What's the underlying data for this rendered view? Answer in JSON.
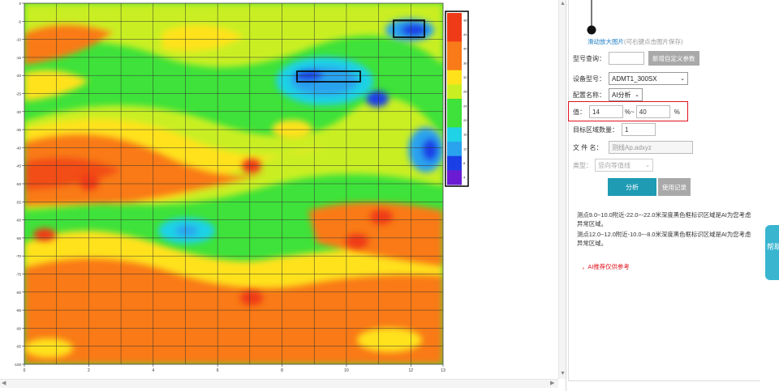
{
  "chart": {
    "y_ticks": [
      "0",
      "-5",
      "-10",
      "-15",
      "-20",
      "-25",
      "-30",
      "-35",
      "-40",
      "-45",
      "-50",
      "-55",
      "-60",
      "-65",
      "-70",
      "-75",
      "-80",
      "-85",
      "-90",
      "-95",
      "-100"
    ],
    "x_ticks": [
      "0",
      "2",
      "4",
      "6",
      "8",
      "10",
      "12",
      "13"
    ],
    "colorbar_ticks": [
      "48",
      "44",
      "40",
      "36",
      "32",
      "28",
      "24",
      "20",
      "16",
      "12",
      "8",
      "4"
    ],
    "colors": {
      "red": "#ef3b17",
      "orange": "#f97a18",
      "yellow": "#ffe21a",
      "yellowgreen": "#c9ef22",
      "green": "#3ee23a",
      "cyan": "#1fd2e6",
      "skyblue": "#2aa3ee",
      "blue": "#1a3fe6",
      "purple": "#6b1bd2"
    }
  },
  "panel": {
    "zoom_link": "滑动放大图片",
    "zoom_hint": "(可右键点击图片保存)",
    "model_query_label": "型号查询：",
    "model_query_value": "",
    "add_param_button": "新增自定义参数",
    "device_label": "设备型号：",
    "device_value": "ADMT1_300SX",
    "profile_label": "配置名称：",
    "profile_value": "AI分析",
    "value_label": "值：",
    "value_min": "14",
    "value_sep": "%~",
    "value_max": "40",
    "value_unit": "%",
    "target_count_label": "目标区域数量：",
    "target_count_value": "1",
    "file_label": "文 件 名：",
    "file_value": "测线Ap.adxyz",
    "type_label": "类型：",
    "type_value": "竖向等值线",
    "analyze_button": "分析",
    "record_button": "使用记录",
    "result_1": "测点9.0~10.0附近-22.0~-22.0米深度黑色框标识区域是AI为您考虑异常区域。",
    "result_2": "测点12.0~12.0附近-10.0~-8.0米深度黑色框标识区域是AI为您考虑异常区域。",
    "note": "，AI推荐仅供参考",
    "side_tab": "帮助"
  }
}
